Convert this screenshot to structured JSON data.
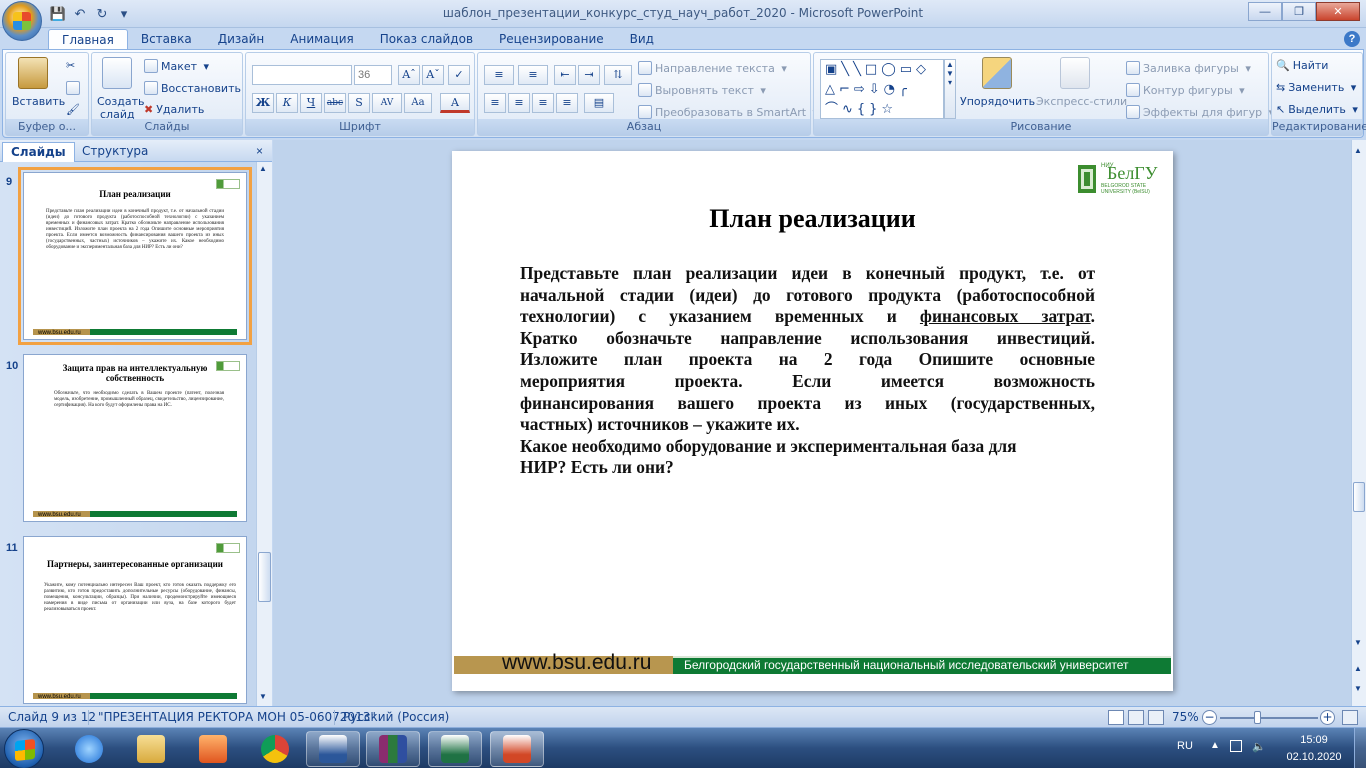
{
  "app": {
    "window_title": "шаблон_презентации_конкурс_студ_науч_работ_2020 - Microsoft PowerPoint"
  },
  "ribbon": {
    "tabs": [
      "Главная",
      "Вставка",
      "Дизайн",
      "Анимация",
      "Показ слайдов",
      "Рецензирование",
      "Вид"
    ],
    "active_tab": "Главная",
    "clipboard": {
      "paste": "Вставить",
      "label": "Буфер о..."
    },
    "slides_group": {
      "create": "Создать",
      "create2": "слайд",
      "layout": "Макет",
      "reset": "Восстановить",
      "delete": "Удалить",
      "label": "Слайды"
    },
    "font": {
      "size": "36",
      "label": "Шрифт",
      "bold": "Ж",
      "italic": "К",
      "underline": "Ч",
      "strike": "abc",
      "shadow": "S",
      "spacing": "AV",
      "case": "Aa",
      "color": "A"
    },
    "paragraph": {
      "text_direction": "Направление текста",
      "align_text": "Выровнять текст",
      "smartart": "Преобразовать в SmartArt",
      "label": "Абзац"
    },
    "drawing": {
      "arrange": "Упорядочить",
      "styles": "Экспресс-стили",
      "fill": "Заливка фигуры",
      "outline": "Контур фигуры",
      "effects": "Эффекты для фигур",
      "label": "Рисование"
    },
    "editing": {
      "find": "Найти",
      "replace": "Заменить",
      "select": "Выделить",
      "label": "Редактирование"
    }
  },
  "panel": {
    "tab_slides": "Слайды",
    "tab_outline": "Структура",
    "thumbs": [
      {
        "num": "9",
        "title": "План реализации",
        "text": "Представьте план реализации идеи в конечный продукт, т.е. от начальной стадии (идеи) до готового продукта (работоспособной технологии) с указанием временных и финансовых затрат. Кратко обозначьте направление использования инвестиций. Изложите план проекта на 2 года Опишите основные мероприятия проекта. Если имеется возможность финансирования вашего проекта из иных (государственных, частных) источников – укажите их. Какое необходимо оборудование и экспериментальная база для НИР? Есть ли они?"
      },
      {
        "num": "10",
        "title": "Защита прав на интеллектуальную собственность",
        "text": "Обозначьте, что необходимо сделать в Вашем проекте (патент, полезная модель, изобретение, промышленный образец, свидетельство, лицензирование, сертификация). На кого будут оформлены права на ИС."
      },
      {
        "num": "11",
        "title": "Партнеры, заинтересованные организации",
        "text": "Укажите, кому потенциально интересен Ваш проект, кто готов оказать поддержку его развитию, кто готов предоставить дополнительные ресурсы (оборудование, финансы, помещения, консультации, образцы). При наличии, продемонстрируйте имеющиеся намерения в виде письма от организации или вуза, на базе которого будет реализовываться проект."
      }
    ],
    "footer_url": "www.bsu.edu.ru"
  },
  "slide": {
    "title": "План реализации",
    "lines_justified": [
      "Представьте план реализации идеи в конечный продукт, т.е. от",
      "начальной стадии (идеи) до готового продукта (работоспособной",
      "технологии) с указанием временных и",
      "Кратко обозначьте направление использования инвестиций.",
      "Изложите план проекта на 2 года Опишите основные",
      "мероприятия проекта. Если имеется возможность",
      "финансирования вашего проекта из иных (государственных,"
    ],
    "underlined": "финансовых затрат",
    "after_underlined": ".",
    "lines_left": [
      "частных) источников – укажите их.",
      "Какое необходимо оборудование и экспериментальная база для",
      "НИР? Есть ли они?"
    ],
    "logo": {
      "niu": "НИУ",
      "name": "БелГУ",
      "sub1": "BELGOROD STATE",
      "sub2": "UNIVERSITY (BelSU)"
    },
    "footer_url": "www.bsu.edu.ru",
    "footer_university": "Белгородский государственный национальный исследовательский университет"
  },
  "status": {
    "slide_counter": "Слайд 9 из 12",
    "theme": "\"ПРЕЗЕНТАЦИЯ РЕКТОРА МОН 05-06072013\"",
    "language": "Русский (Россия)",
    "zoom": "75%"
  },
  "taskbar": {
    "lang": "RU",
    "time": "15:09",
    "date": "02.10.2020"
  }
}
